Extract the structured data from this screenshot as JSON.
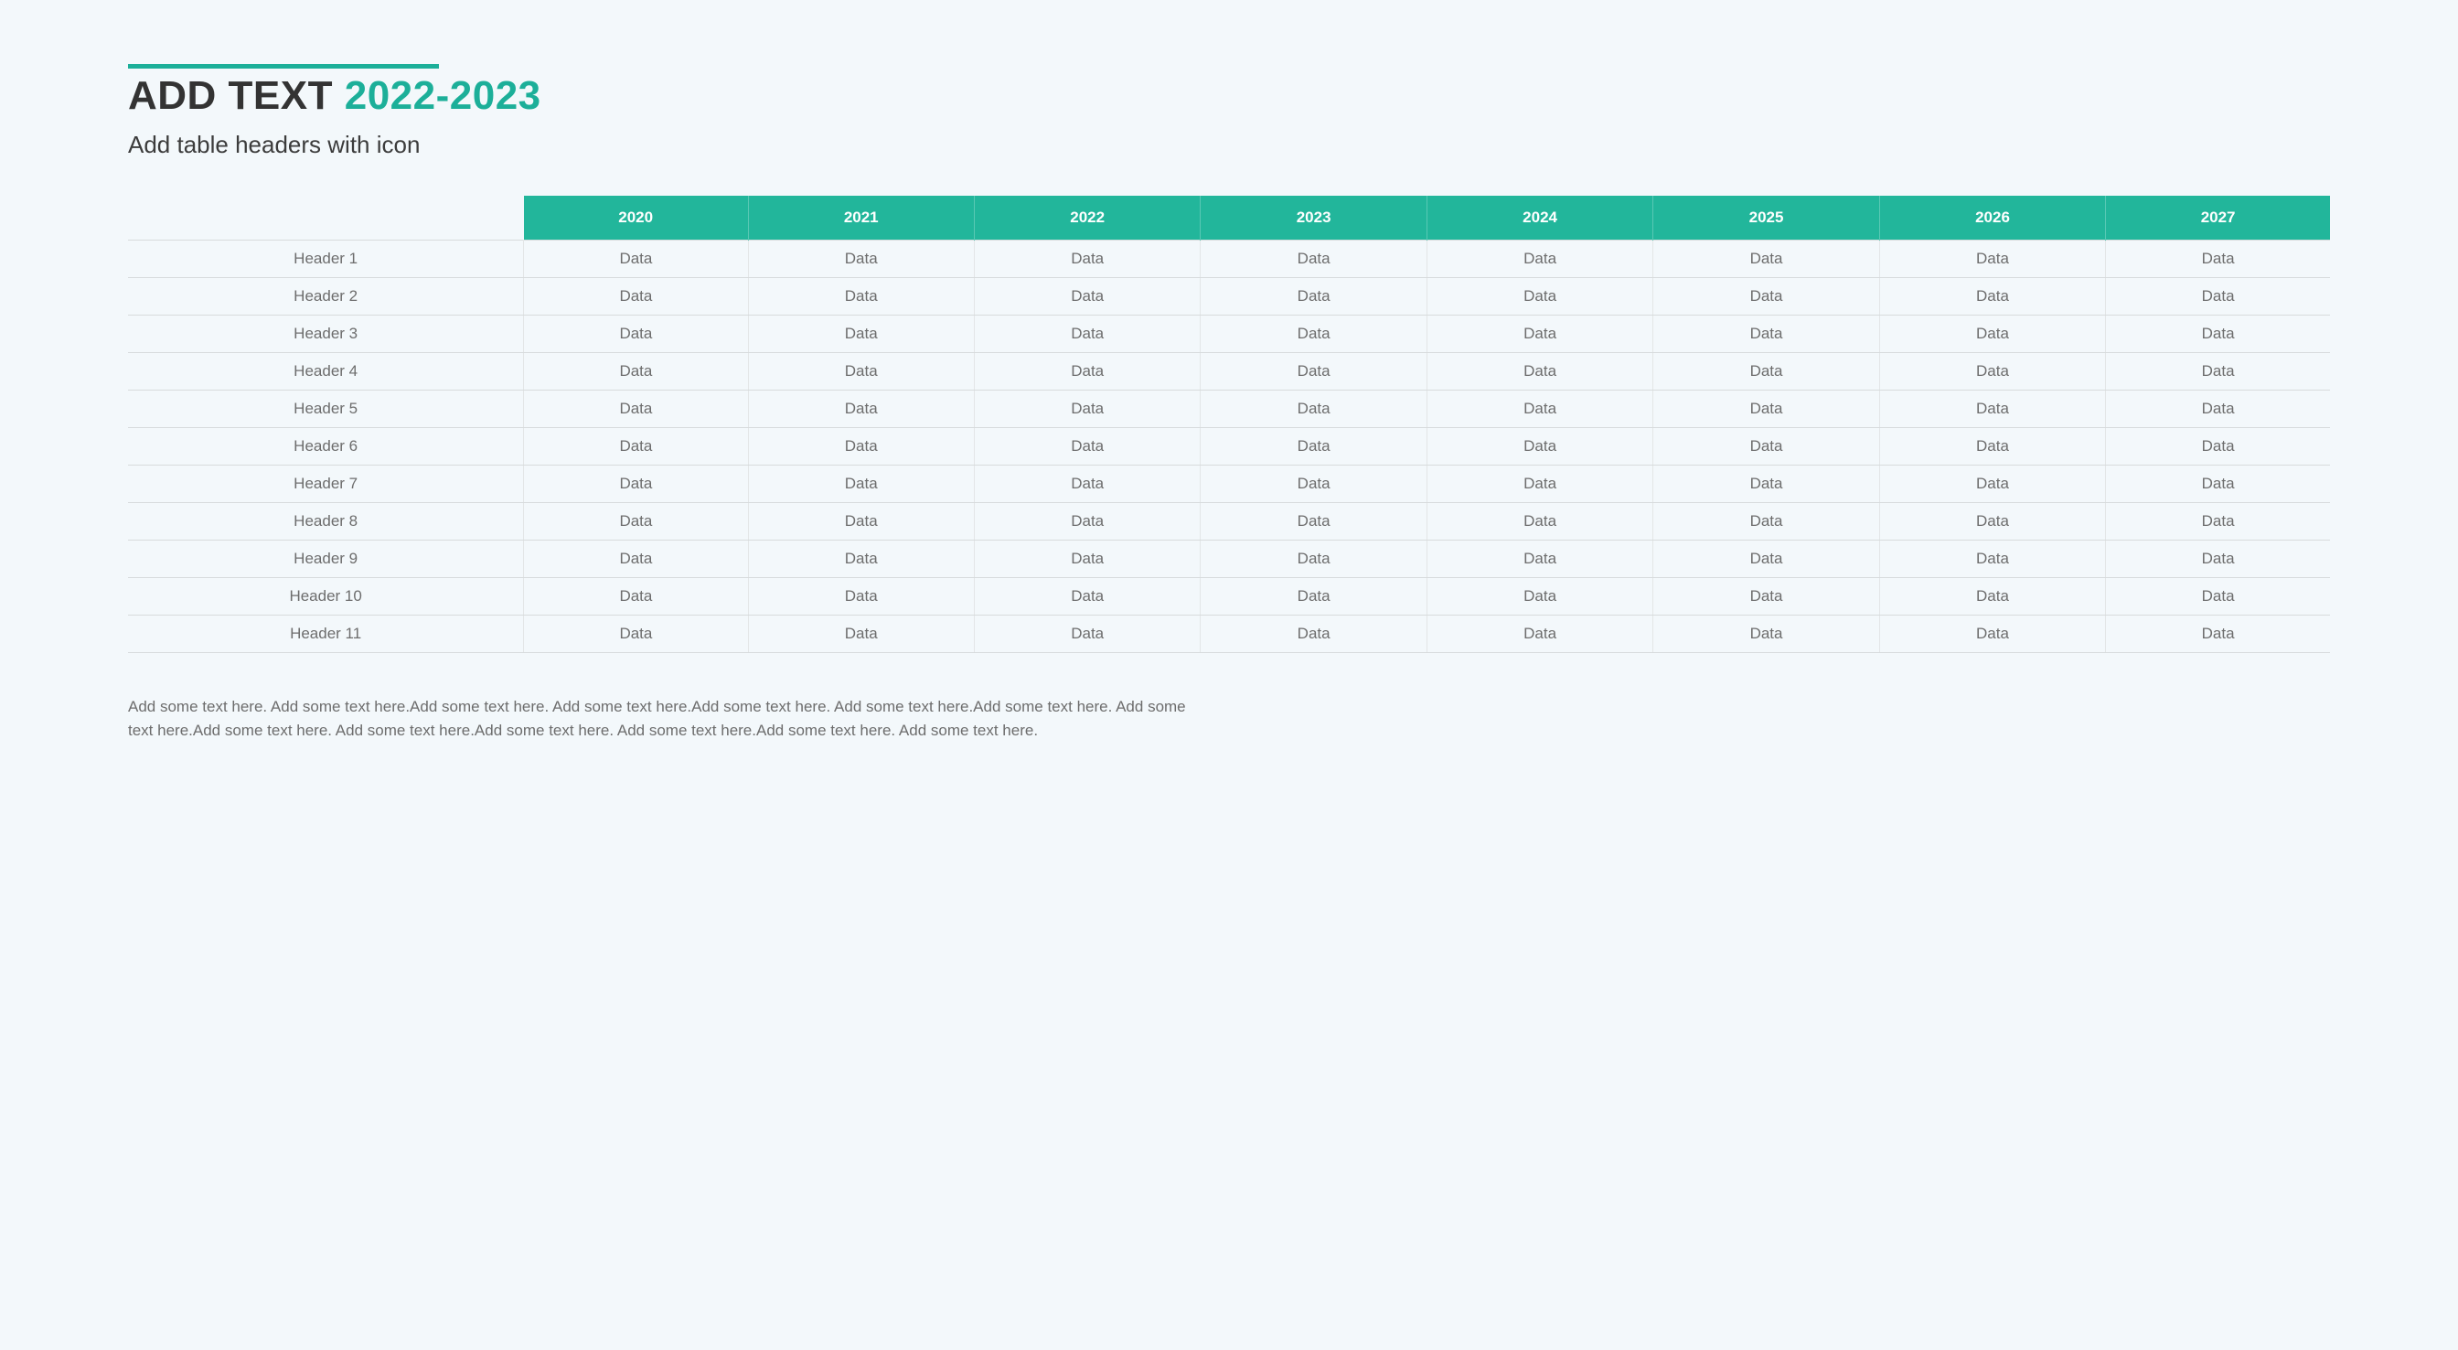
{
  "title": {
    "black": "ADD TEXT",
    "accent": "2022-2023"
  },
  "subtitle": "Add table headers with icon",
  "table": {
    "columns": [
      "2020",
      "2021",
      "2022",
      "2023",
      "2024",
      "2025",
      "2026",
      "2027"
    ],
    "rows": [
      {
        "header": "Header 1",
        "cells": [
          "Data",
          "Data",
          "Data",
          "Data",
          "Data",
          "Data",
          "Data",
          "Data"
        ]
      },
      {
        "header": "Header 2",
        "cells": [
          "Data",
          "Data",
          "Data",
          "Data",
          "Data",
          "Data",
          "Data",
          "Data"
        ]
      },
      {
        "header": "Header 3",
        "cells": [
          "Data",
          "Data",
          "Data",
          "Data",
          "Data",
          "Data",
          "Data",
          "Data"
        ]
      },
      {
        "header": "Header 4",
        "cells": [
          "Data",
          "Data",
          "Data",
          "Data",
          "Data",
          "Data",
          "Data",
          "Data"
        ]
      },
      {
        "header": "Header 5",
        "cells": [
          "Data",
          "Data",
          "Data",
          "Data",
          "Data",
          "Data",
          "Data",
          "Data"
        ]
      },
      {
        "header": "Header 6",
        "cells": [
          "Data",
          "Data",
          "Data",
          "Data",
          "Data",
          "Data",
          "Data",
          "Data"
        ]
      },
      {
        "header": "Header 7",
        "cells": [
          "Data",
          "Data",
          "Data",
          "Data",
          "Data",
          "Data",
          "Data",
          "Data"
        ]
      },
      {
        "header": "Header 8",
        "cells": [
          "Data",
          "Data",
          "Data",
          "Data",
          "Data",
          "Data",
          "Data",
          "Data"
        ]
      },
      {
        "header": "Header 9",
        "cells": [
          "Data",
          "Data",
          "Data",
          "Data",
          "Data",
          "Data",
          "Data",
          "Data"
        ]
      },
      {
        "header": "Header 10",
        "cells": [
          "Data",
          "Data",
          "Data",
          "Data",
          "Data",
          "Data",
          "Data",
          "Data"
        ]
      },
      {
        "header": "Header 11",
        "cells": [
          "Data",
          "Data",
          "Data",
          "Data",
          "Data",
          "Data",
          "Data",
          "Data"
        ]
      }
    ]
  },
  "footer": "Add some text here. Add some text here.Add some text here. Add some text here.Add some text here. Add some text here.Add some text here. Add some text here.Add some text here. Add some text here.Add some text here. Add some text here.Add some text here. Add some text here."
}
